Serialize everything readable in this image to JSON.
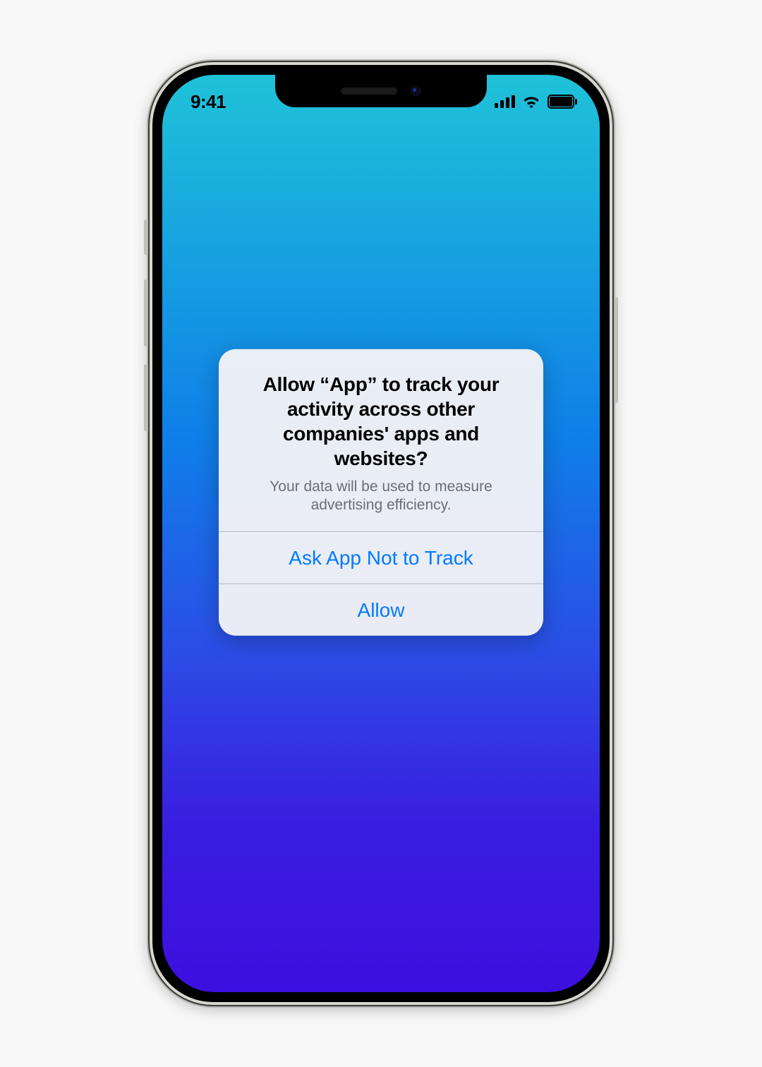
{
  "status_bar": {
    "time": "9:41"
  },
  "alert": {
    "title": "Allow “App” to track your activity across other companies' apps and websites?",
    "message": "Your data will be used to measure advertising efficiency.",
    "buttons": {
      "deny": "Ask App Not to Track",
      "allow": "Allow"
    }
  },
  "colors": {
    "ios_blue": "#007aff",
    "gradient_top": "#1fc2d8",
    "gradient_bottom": "#3d0fdf"
  }
}
